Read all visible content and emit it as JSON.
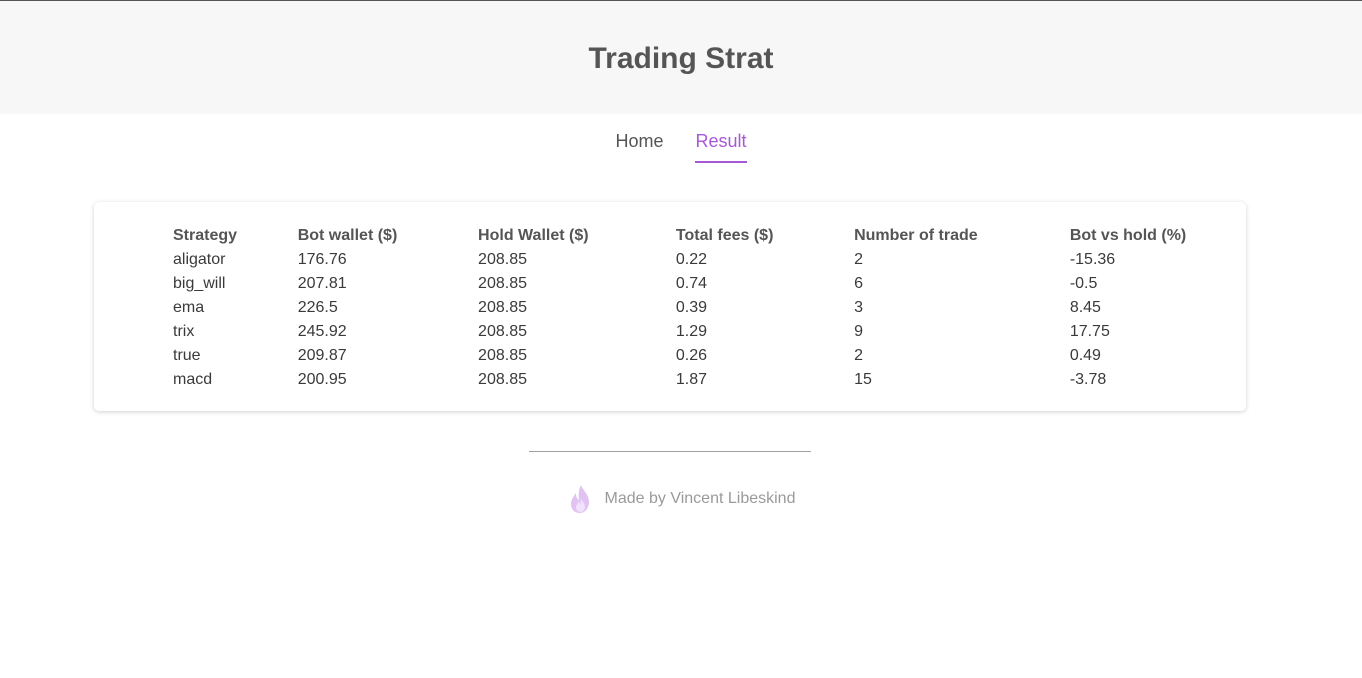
{
  "header": {
    "title": "Trading Strat"
  },
  "nav": {
    "items": [
      {
        "label": "Home"
      },
      {
        "label": "Result"
      }
    ],
    "active": "Result"
  },
  "table": {
    "columns": [
      "Strategy",
      "Bot wallet ($)",
      "Hold Wallet ($)",
      "Total fees ($)",
      "Number of trade",
      "Bot vs hold (%)"
    ],
    "rows": [
      [
        "aligator",
        "176.76",
        "208.85",
        "0.22",
        "2",
        "-15.36"
      ],
      [
        "big_will",
        "207.81",
        "208.85",
        "0.74",
        "6",
        "-0.5"
      ],
      [
        "ema",
        "226.5",
        "208.85",
        "0.39",
        "3",
        "8.45"
      ],
      [
        "trix",
        "245.92",
        "208.85",
        "1.29",
        "9",
        "17.75"
      ],
      [
        "true",
        "209.87",
        "208.85",
        "0.26",
        "2",
        "0.49"
      ],
      [
        "macd",
        "200.95",
        "208.85",
        "1.87",
        "15",
        "-3.78"
      ]
    ]
  },
  "footer": {
    "text": "Made by Vincent Libeskind",
    "icon": "flame-icon"
  },
  "colors": {
    "accent": "#a758d8",
    "header_bg": "#f7f7f7"
  }
}
